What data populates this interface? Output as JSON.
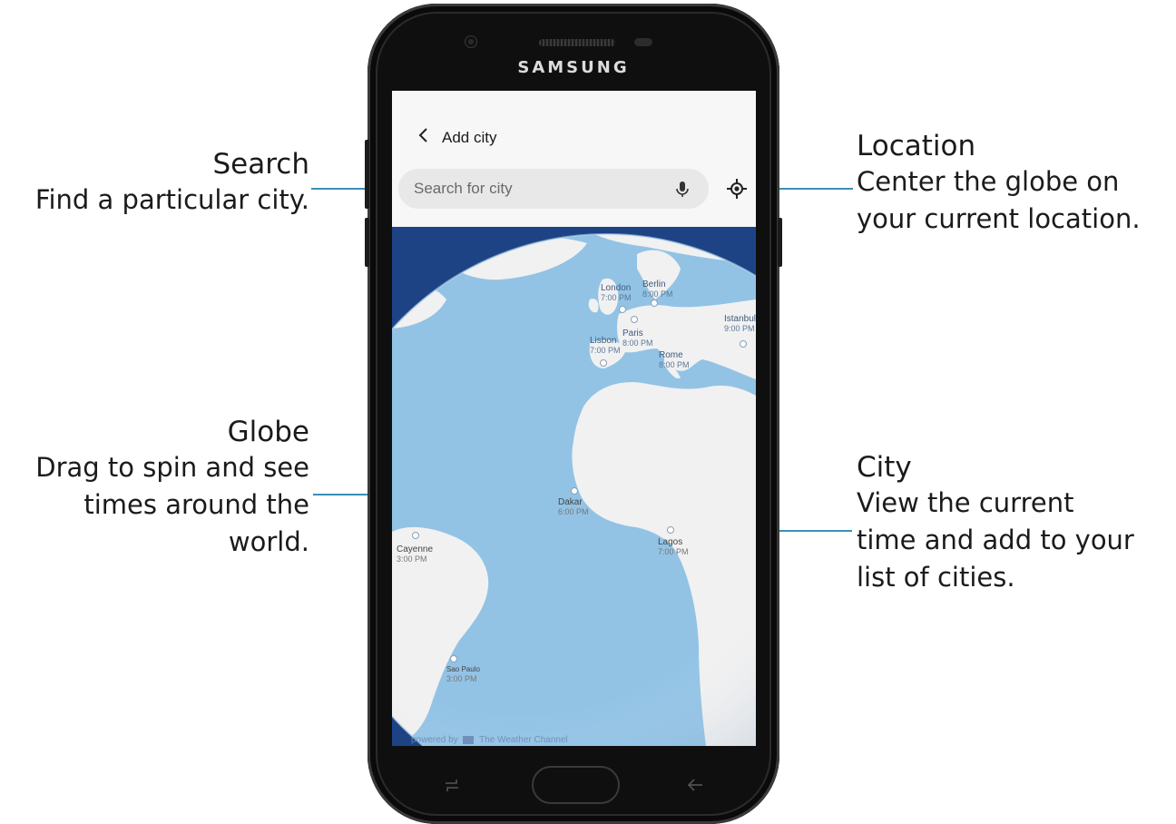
{
  "device": {
    "brand": "SAMSUNG"
  },
  "app": {
    "header_title": "Add city",
    "search_placeholder": "Search for city",
    "powered_by": "powered by",
    "powered_brand": "The Weather Channel"
  },
  "cities": [
    {
      "name": "London",
      "time": "7:00 PM"
    },
    {
      "name": "Berlin",
      "time": "8:00 PM"
    },
    {
      "name": "Paris",
      "time": "8:00 PM"
    },
    {
      "name": "Lisbon",
      "time": "7:00 PM"
    },
    {
      "name": "Istanbul",
      "time": "9:00 PM"
    },
    {
      "name": "Rome",
      "time": "8:00 PM"
    },
    {
      "name": "Dakar",
      "time": "6:00 PM"
    },
    {
      "name": "Lagos",
      "time": "7:00 PM"
    },
    {
      "name": "Cayenne",
      "time": "3:00 PM"
    },
    {
      "name": "Sao Paulo",
      "time": "3:00 PM"
    }
  ],
  "callouts": {
    "search": {
      "title": "Search",
      "line1": "Find a particular city."
    },
    "globe": {
      "title": "Globe",
      "line1": "Drag to spin and see",
      "line2": "times around the",
      "line3": "world."
    },
    "location": {
      "title": "Location",
      "line1": "Center the globe on",
      "line2": "your current location."
    },
    "city": {
      "title": "City",
      "line1": "View the current",
      "line2": "time and add to your",
      "line3": "list of cities."
    }
  },
  "colors": {
    "accent": "#3a8fb7",
    "ocean": "#1d4385",
    "globe": "#92c3e5",
    "land": "#f1f1f1"
  }
}
